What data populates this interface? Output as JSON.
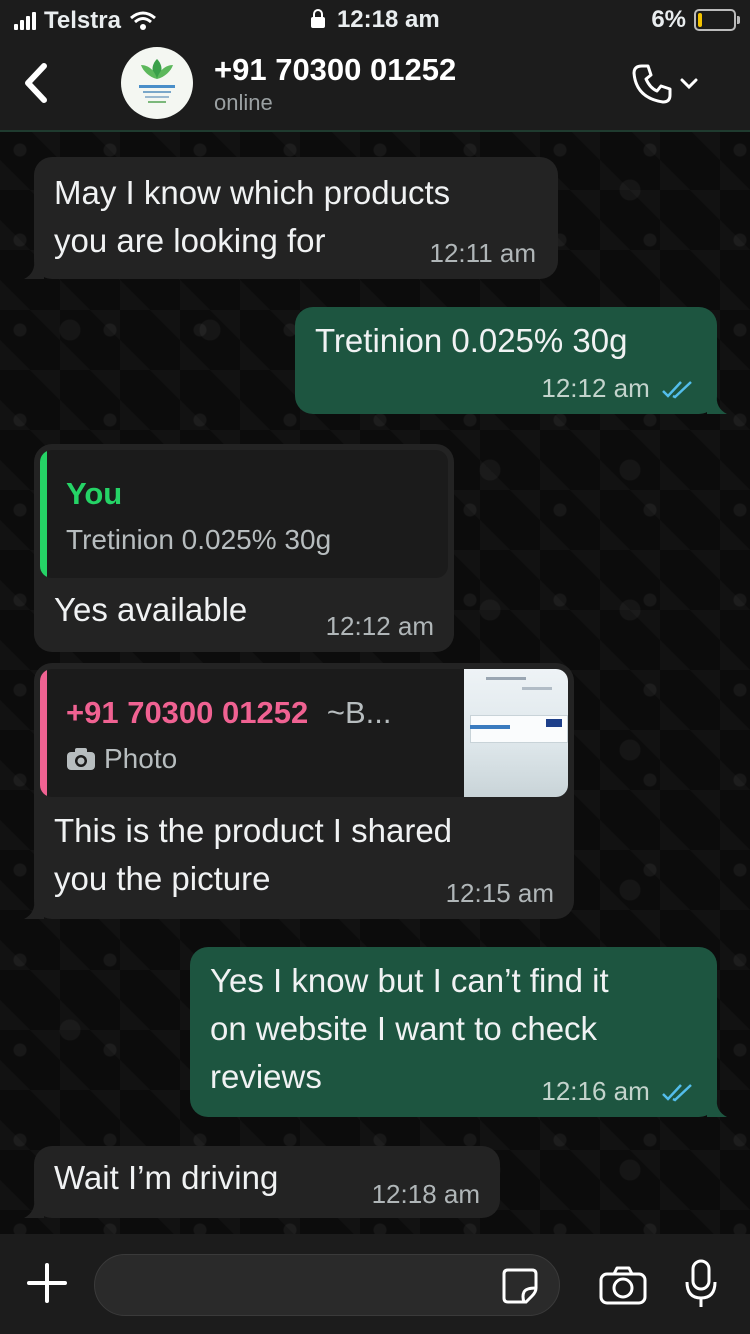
{
  "status_bar": {
    "carrier": "Telstra",
    "time": "12:18 am",
    "battery": "6%",
    "icons": [
      "signal-icon",
      "wifi-icon",
      "lock-icon",
      "battery-icon"
    ]
  },
  "header": {
    "contact_name": "+91 70300 01252",
    "status": "online",
    "icons": [
      "back-icon",
      "phone-icon",
      "chevron-down-icon"
    ]
  },
  "messages": [
    {
      "direction": "incoming",
      "text_lines": [
        "May I know which products",
        "you are looking for"
      ],
      "time": "12:11 am"
    },
    {
      "direction": "outgoing",
      "text": "Tretinion 0.025% 30g",
      "time": "12:12 am",
      "read": true
    },
    {
      "direction": "incoming",
      "quote": {
        "author": "You",
        "text": "Tretinion 0.025% 30g"
      },
      "text": "Yes available",
      "time": "12:12 am"
    },
    {
      "direction": "incoming",
      "quote": {
        "author": "+91 70300 01252",
        "author_suffix": "~B...",
        "media_label": "Photo"
      },
      "text_lines": [
        "This is the product I shared",
        "you the picture"
      ],
      "time": "12:15 am"
    },
    {
      "direction": "outgoing",
      "text_lines": [
        "Yes I know but I can’t find it",
        "on website I want to check",
        "reviews"
      ],
      "time": "12:16 am",
      "read": true
    },
    {
      "direction": "incoming",
      "text": "Wait I’m driving",
      "time": "12:18 am"
    }
  ],
  "colors": {
    "incoming_bubble": "#232323",
    "outgoing_bubble": "#1d5540",
    "quote_you": "#25d366",
    "quote_contact": "#f06292",
    "read_ticks": "#53bdeb"
  }
}
